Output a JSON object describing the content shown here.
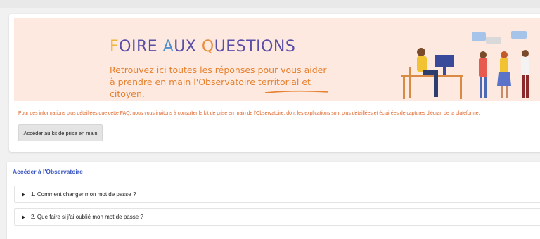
{
  "banner": {
    "title_first_letter_1": "F",
    "title_rest_1": "OIRE ",
    "title_first_letter_2": "A",
    "title_rest_2": "UX ",
    "title_first_letter_3": "Q",
    "title_rest_3": "UESTIONS",
    "subtitle_line1": "Retrouvez ici toutes les réponses pour vous aider",
    "subtitle_line2": "à prendre en main l'Observatoire territorial et citoyen.",
    "colors": {
      "background": "#fde9e0",
      "title": "#5a4ea6",
      "subtitle": "#e6812f"
    }
  },
  "info": {
    "text": "Pour des informations plus détaillées que cette FAQ, nous vous invitons à consulter le kit de prise en main de l'Observatoire, dont les explications sont plus détaillées et éclairées de captures d'écran de la plateforme.",
    "button_label": "Accéder au kit de prise en main"
  },
  "section": {
    "title": "Accéder à l'Observatoire",
    "questions": [
      "1. Comment changer mon mot de passe ?",
      "2. Que faire si j'ai oublié mon mot de passe ?"
    ]
  }
}
